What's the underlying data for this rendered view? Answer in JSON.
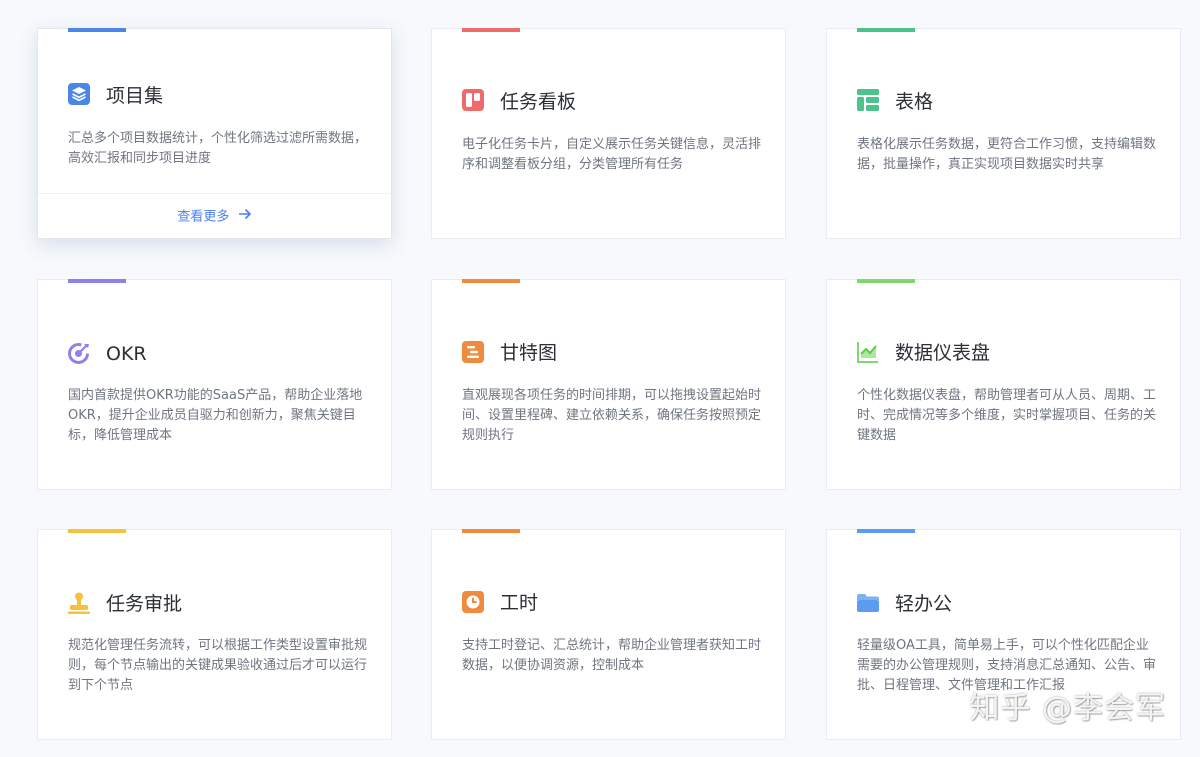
{
  "cards": [
    {
      "title": "项目集",
      "desc": "汇总多个项目数据统计，个性化筛选过滤所需数据，高效汇报和同步项目进度",
      "icon": "layers-icon",
      "color": "#4a86e8",
      "more": "查看更多"
    },
    {
      "title": "任务看板",
      "desc": "电子化任务卡片，自定义展示任务关键信息，灵活排序和调整看板分组，分类管理所有任务",
      "icon": "kanban-icon",
      "color": "#ef6b6b"
    },
    {
      "title": "表格",
      "desc": "表格化展示任务数据，更符合工作习惯，支持编辑数据，批量操作，真正实现项目数据实时共享",
      "icon": "table-icon",
      "color": "#4cc38a"
    },
    {
      "title": "OKR",
      "desc": "国内首款提供OKR功能的SaaS产品，帮助企业落地OKR，提升企业成员自驱力和创新力，聚焦关键目标，降低管理成本",
      "icon": "target-icon",
      "color": "#8e82ea"
    },
    {
      "title": "甘特图",
      "desc": "直观展现各项任务的时间排期，可以拖拽设置起始时间、设置里程碑、建立依赖关系，确保任务按照预定规则执行",
      "icon": "gantt-icon",
      "color": "#f08a3c"
    },
    {
      "title": "数据仪表盘",
      "desc": "个性化数据仪表盘，帮助管理者可从人员、周期、工时、完成情况等多个维度，实时掌握项目、任务的关键数据",
      "icon": "chart-icon",
      "color": "#7fd86e"
    },
    {
      "title": "任务审批",
      "desc": "规范化管理任务流转，可以根据工作类型设置审批规则，每个节点输出的关键成果验收通过后才可以运行到下个节点",
      "icon": "stamp-icon",
      "color": "#f5c23b"
    },
    {
      "title": "工时",
      "desc": "支持工时登记、汇总统计，帮助企业管理者获知工时数据，以便协调资源，控制成本",
      "icon": "clock-icon",
      "color": "#f08a3c"
    },
    {
      "title": "轻办公",
      "desc": "轻量级OA工具，简单易上手，可以个性化匹配企业需要的办公管理规则，支持消息汇总通知、公告、审批、日程管理、文件管理和工作汇报",
      "icon": "folder-icon",
      "color": "#5b9bf0"
    }
  ],
  "watermark": "知乎 @李会军"
}
